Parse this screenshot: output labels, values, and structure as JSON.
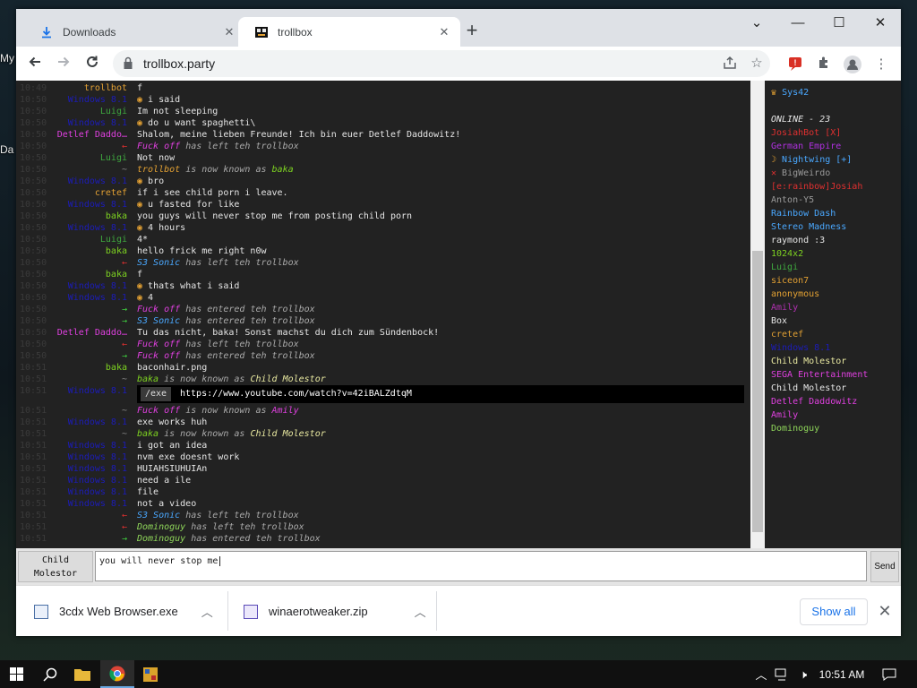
{
  "desktop": {
    "icon_label_1": "My",
    "icon_label_2": "Da"
  },
  "browser": {
    "tabs": [
      {
        "label": "Downloads",
        "close": "✕"
      },
      {
        "label": "trollbox",
        "close": "✕"
      }
    ],
    "new_tab": "+",
    "window_controls": {
      "dropdown": "⌄",
      "minimize": "—",
      "maximize": "☐",
      "close": "✕"
    },
    "url": "trollbox.party"
  },
  "chat": [
    {
      "t": "10:49",
      "nick": "trollbot",
      "nc": "#e2a033",
      "msg": "f",
      "mc": "#e6e6e6",
      "e": false
    },
    {
      "t": "10:50",
      "nick": "Windows 8.1",
      "nc": "#1c1cb8",
      "msg": "i said",
      "mc": "#e6e6e6",
      "e": true
    },
    {
      "t": "10:50",
      "nick": "Luigi",
      "nc": "#3fa83f",
      "msg": "Im not sleeping",
      "mc": "#e6e6e6",
      "e": false
    },
    {
      "t": "10:50",
      "nick": "Windows 8.1",
      "nc": "#1c1cb8",
      "msg": "do u want spaghetti\\",
      "mc": "#e6e6e6",
      "e": true
    },
    {
      "t": "10:50",
      "nick": "Detlef Daddo…",
      "nc": "#e040e0",
      "msg": "Shalom, meine lieben Freunde! Ich bin euer Detlef Daddowitz!",
      "mc": "#e6e6e6",
      "e": false
    },
    {
      "t": "10:50",
      "nick": "←",
      "nc": "#e03030",
      "sys": [
        [
          "Fuck off",
          "#e040e0"
        ],
        [
          " has left teh trollbox",
          "#aaaaaa"
        ]
      ]
    },
    {
      "t": "10:50",
      "nick": "Luigi",
      "nc": "#3fa83f",
      "msg": "Not now",
      "mc": "#e6e6e6",
      "e": false
    },
    {
      "t": "10:50",
      "nick": "~",
      "nc": "#888888",
      "sys": [
        [
          "trollbot",
          "#e2a033"
        ],
        [
          " is now known as ",
          "#aaaaaa"
        ],
        [
          "baka",
          "#7ed321"
        ]
      ]
    },
    {
      "t": "10:50",
      "nick": "Windows 8.1",
      "nc": "#1c1cb8",
      "msg": "bro",
      "mc": "#e6e6e6",
      "e": true
    },
    {
      "t": "10:50",
      "nick": "cretef",
      "nc": "#e2a033",
      "msg": "if i see child porn i leave.",
      "mc": "#e6e6e6",
      "e": false
    },
    {
      "t": "10:50",
      "nick": "Windows 8.1",
      "nc": "#1c1cb8",
      "msg": "u fasted for like",
      "mc": "#e6e6e6",
      "e": true
    },
    {
      "t": "10:50",
      "nick": "baka",
      "nc": "#7ed321",
      "msg": "you guys will never stop me from posting child porn",
      "mc": "#e6e6e6",
      "e": false
    },
    {
      "t": "10:50",
      "nick": "Windows 8.1",
      "nc": "#1c1cb8",
      "msg": "4 hours",
      "mc": "#e6e6e6",
      "e": true
    },
    {
      "t": "10:50",
      "nick": "Luigi",
      "nc": "#3fa83f",
      "msg": "4*",
      "mc": "#e6e6e6",
      "e": false
    },
    {
      "t": "10:50",
      "nick": "baka",
      "nc": "#7ed321",
      "msg": "hello frick me right n0w",
      "mc": "#e6e6e6",
      "e": false
    },
    {
      "t": "10:50",
      "nick": "←",
      "nc": "#e03030",
      "sys": [
        [
          "S3 Sonic",
          "#4aa8ff"
        ],
        [
          " has left teh trollbox",
          "#aaaaaa"
        ]
      ]
    },
    {
      "t": "10:50",
      "nick": "baka",
      "nc": "#7ed321",
      "msg": "f",
      "mc": "#e6e6e6",
      "e": false
    },
    {
      "t": "10:50",
      "nick": "Windows 8.1",
      "nc": "#1c1cb8",
      "msg": "thats what i said",
      "mc": "#e6e6e6",
      "e": true
    },
    {
      "t": "10:50",
      "nick": "Windows 8.1",
      "nc": "#1c1cb8",
      "msg": "4",
      "mc": "#e6e6e6",
      "e": true
    },
    {
      "t": "10:50",
      "nick": "→",
      "nc": "#3fcf3f",
      "sys": [
        [
          "Fuck off",
          "#e040e0"
        ],
        [
          " has entered teh trollbox",
          "#aaaaaa"
        ]
      ]
    },
    {
      "t": "10:50",
      "nick": "→",
      "nc": "#3fcf3f",
      "sys": [
        [
          "S3 Sonic",
          "#4aa8ff"
        ],
        [
          " has entered teh trollbox",
          "#aaaaaa"
        ]
      ]
    },
    {
      "t": "10:50",
      "nick": "Detlef Daddo…",
      "nc": "#e040e0",
      "msg": "Tu das nicht, baka! Sonst machst du dich zum Sündenbock!",
      "mc": "#e6e6e6",
      "e": false
    },
    {
      "t": "10:50",
      "nick": "←",
      "nc": "#e03030",
      "sys": [
        [
          "Fuck off",
          "#e040e0"
        ],
        [
          " has left teh trollbox",
          "#aaaaaa"
        ]
      ]
    },
    {
      "t": "10:50",
      "nick": "→",
      "nc": "#3fcf3f",
      "sys": [
        [
          "Fuck off",
          "#e040e0"
        ],
        [
          " has entered teh trollbox",
          "#aaaaaa"
        ]
      ]
    },
    {
      "t": "10:51",
      "nick": "baka",
      "nc": "#7ed321",
      "msg": "baconhair.png",
      "mc": "#e6e6e6",
      "e": false
    },
    {
      "t": "10:51",
      "nick": "~",
      "nc": "#888888",
      "sys": [
        [
          "baka",
          "#7ed321"
        ],
        [
          " is now known as ",
          "#aaaaaa"
        ],
        [
          "Child Molestor",
          "#e8e8a0"
        ]
      ]
    },
    {
      "t": "10:51",
      "nick": "Windows 8.1",
      "nc": "#1c1cb8",
      "embed": true
    },
    {
      "t": "10:51",
      "nick": "~",
      "nc": "#888888",
      "sys": [
        [
          "Fuck off",
          "#e040e0"
        ],
        [
          " is now known as ",
          "#aaaaaa"
        ],
        [
          "Amily",
          "#e040e0"
        ]
      ]
    },
    {
      "t": "10:51",
      "nick": "Windows 8.1",
      "nc": "#1c1cb8",
      "msg": "exe works huh",
      "mc": "#e6e6e6",
      "e": false
    },
    {
      "t": "10:51",
      "nick": "~",
      "nc": "#888888",
      "sys": [
        [
          "baka",
          "#7ed321"
        ],
        [
          " is now known as ",
          "#aaaaaa"
        ],
        [
          "Child Molestor",
          "#e8e8a0"
        ]
      ]
    },
    {
      "t": "10:51",
      "nick": "Windows 8.1",
      "nc": "#1c1cb8",
      "msg": "i got an idea",
      "mc": "#e6e6e6",
      "e": false
    },
    {
      "t": "10:51",
      "nick": "Windows 8.1",
      "nc": "#1c1cb8",
      "msg": "nvm exe doesnt work",
      "mc": "#e6e6e6",
      "e": false
    },
    {
      "t": "10:51",
      "nick": "Windows 8.1",
      "nc": "#1c1cb8",
      "msg": "HUIAHSIUHUIAn",
      "mc": "#e6e6e6",
      "e": false
    },
    {
      "t": "10:51",
      "nick": "Windows 8.1",
      "nc": "#1c1cb8",
      "msg": "need a ile",
      "mc": "#e6e6e6",
      "e": false
    },
    {
      "t": "10:51",
      "nick": "Windows 8.1",
      "nc": "#1c1cb8",
      "msg": "file",
      "mc": "#e6e6e6",
      "e": false
    },
    {
      "t": "10:51",
      "nick": "Windows 8.1",
      "nc": "#1c1cb8",
      "msg": "not a video",
      "mc": "#e6e6e6",
      "e": false
    },
    {
      "t": "10:51",
      "nick": "←",
      "nc": "#e03030",
      "sys": [
        [
          "S3 Sonic",
          "#4aa8ff"
        ],
        [
          " has left teh trollbox",
          "#aaaaaa"
        ]
      ]
    },
    {
      "t": "10:51",
      "nick": "←",
      "nc": "#e03030",
      "sys": [
        [
          "Dominoguy",
          "#8fd65a"
        ],
        [
          " has left teh trollbox",
          "#aaaaaa"
        ]
      ]
    },
    {
      "t": "10:51",
      "nick": "→",
      "nc": "#3fcf3f",
      "sys": [
        [
          "Dominoguy",
          "#8fd65a"
        ],
        [
          " has entered teh trollbox",
          "#aaaaaa"
        ]
      ]
    }
  ],
  "embed": {
    "tag": "/exe",
    "link": "https://www.youtube.com/watch?v=42iBALZdtqM"
  },
  "users": {
    "room": "Sys42",
    "online": "ONLINE - 23",
    "list": [
      {
        "n": "JosiahBot [X]",
        "c": "#e03030"
      },
      {
        "n": "German Empire",
        "c": "#b030e0"
      },
      {
        "n": "Nightwing [+]",
        "c": "#4aa8ff",
        "p": "☽"
      },
      {
        "n": "BigWeirdo",
        "c": "#999999",
        "p": "✕"
      },
      {
        "n": "[e:rainbow]Josiah",
        "c": "#e03030"
      },
      {
        "n": "Anton-Y5",
        "c": "#999999"
      },
      {
        "n": "Rainbow Dash",
        "c": "#4aa8ff"
      },
      {
        "n": "Stereo Madness",
        "c": "#4aa8ff"
      },
      {
        "n": "raymond :3",
        "c": "#e6e6e6"
      },
      {
        "n": "1024x2",
        "c": "#7ed321"
      },
      {
        "n": "Luigi",
        "c": "#3fa83f"
      },
      {
        "n": "siceon7",
        "c": "#e2a033"
      },
      {
        "n": "anonymous",
        "c": "#e2a033"
      },
      {
        "n": "Amily",
        "c": "#b030b0"
      },
      {
        "n": "Box",
        "c": "#e6e6e6"
      },
      {
        "n": "cretef",
        "c": "#e2a033"
      },
      {
        "n": "Windows 8.1",
        "c": "#1c1cb8"
      },
      {
        "n": "Child Molestor",
        "c": "#e8e8a0"
      },
      {
        "n": "SEGA Entertainment",
        "c": "#e040e0"
      },
      {
        "n": "Child Molestor",
        "c": "#e6e6e6"
      },
      {
        "n": "Detlef Daddowitz",
        "c": "#e040e0"
      },
      {
        "n": "Amily",
        "c": "#e040e0"
      },
      {
        "n": "Dominoguy",
        "c": "#8fd65a"
      }
    ]
  },
  "composer": {
    "nick_line1": "Child",
    "nick_line2": "Molestor",
    "input_value": "you will never stop me",
    "send": "Send"
  },
  "downloads": {
    "items": [
      {
        "name": "3cdx Web Browser.exe"
      },
      {
        "name": "winaerotweaker.zip"
      }
    ],
    "show_all": "Show all",
    "close": "✕"
  },
  "taskbar": {
    "time": "10:51 AM"
  },
  "colors": {
    "chat_bg": "#222222",
    "accent": "#1a73e8"
  }
}
